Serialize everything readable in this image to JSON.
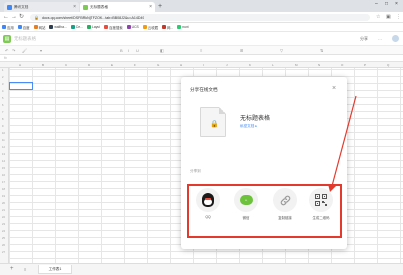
{
  "browser": {
    "tabs": [
      {
        "title": "腾讯文档",
        "color": "#3f88f7"
      },
      {
        "title": "无标题表格",
        "color": "#7ecb54"
      }
    ],
    "new_tab": "+",
    "url": "docs.qq.com/sheet/DSFBRkNjTFZOK...tab=BB08J2&u=A14D49",
    "bookmarks": [
      {
        "label": "应用",
        "color": "#4285f4"
      },
      {
        "label": "百度",
        "color": "#3f88f7"
      },
      {
        "label": "网站",
        "color": "#e67e22"
      },
      {
        "label": "wallha...",
        "color": "#2c3e50"
      },
      {
        "label": "Ce...",
        "color": "#16a085"
      },
      {
        "label": "Layui",
        "color": "#27ae60"
      },
      {
        "label": "百度搜索",
        "color": "#e74c3c"
      },
      {
        "label": "UCS",
        "color": "#8e44ad"
      },
      {
        "label": "云收藏",
        "color": "#f39c12"
      },
      {
        "label": "网...",
        "color": "#c0392b"
      },
      {
        "label": "nuxt",
        "color": "#2ecc71"
      }
    ]
  },
  "doc": {
    "title": "无标题表格",
    "header_buttons": [
      "分享",
      "…"
    ]
  },
  "formula_bar": {
    "fx": "fx"
  },
  "grid": {
    "columns": [
      "A",
      "B",
      "C",
      "D",
      "E",
      "F",
      "G",
      "H",
      "I",
      "J",
      "K",
      "L",
      "M",
      "N",
      "O",
      "P",
      "Q"
    ],
    "rows": [
      "1",
      "2",
      "3",
      "4",
      "5",
      "6",
      "7",
      "8",
      "9",
      "10",
      "11",
      "12",
      "13",
      "14",
      "15",
      "16",
      "17",
      "18",
      "19",
      "20",
      "21",
      "22",
      "23",
      "24",
      "25",
      "26",
      "27"
    ]
  },
  "sheet": {
    "add": "+",
    "menu": "≡",
    "tab_label": "工作表1"
  },
  "dialog": {
    "title": "分享在线文档",
    "close": "×",
    "doc_name": "无标题表格",
    "permission": "私密文档 ▸",
    "share_to_label": "分享到",
    "options": [
      {
        "label": "QQ",
        "icon": "qq-icon"
      },
      {
        "label": "微信",
        "icon": "wechat-icon"
      },
      {
        "label": "复制链接",
        "icon": "link-icon"
      },
      {
        "label": "生成二维码",
        "icon": "qr-code-icon"
      }
    ]
  },
  "colors": {
    "annotation_red": "#e23b2e",
    "link_blue": "#3f88f7",
    "wechat_green": "#6dc23c"
  }
}
